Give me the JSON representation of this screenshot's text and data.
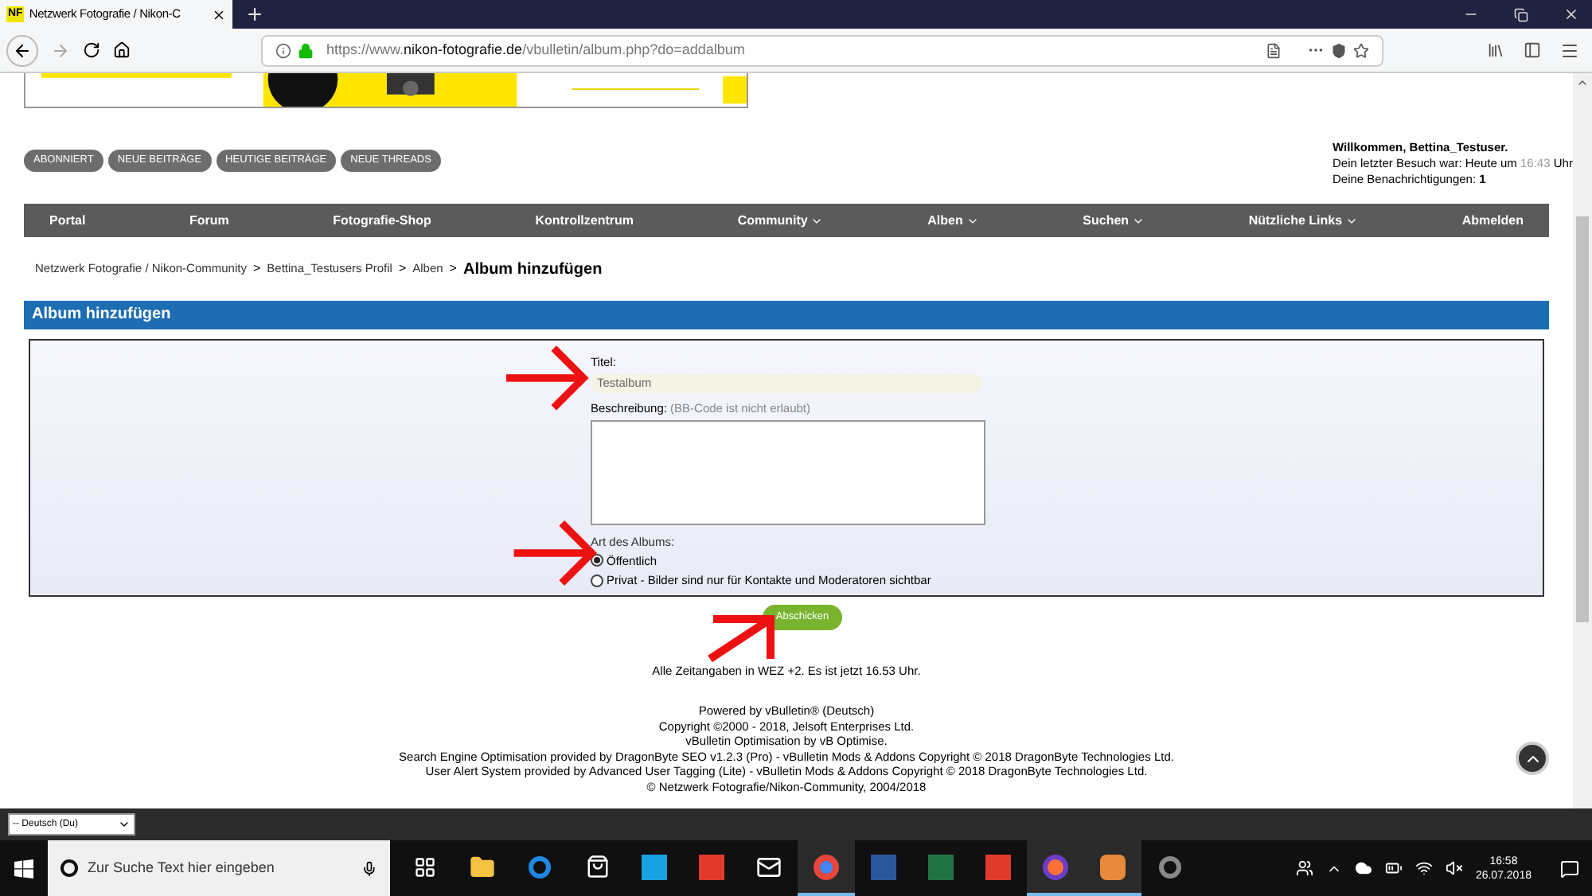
{
  "browser": {
    "tab": {
      "icon_text": "NF",
      "title": "Netzwerk Fotografie / Nikon-C",
      "selected": true
    },
    "url": {
      "prefix": "https://www.",
      "domain": "nikon-fotografie.de",
      "path": "/vbulletin/album.php?do=addalbum"
    }
  },
  "quick_links": [
    "ABONNIERT",
    "NEUE BEITRÄGE",
    "HEUTIGE BEITRÄGE",
    "NEUE THREADS"
  ],
  "welcome": {
    "greeting": "Willkommen, Bettina_Testuser.",
    "last_visit_label": "Dein letzter Besuch war: Heute um",
    "last_visit_time": "16:43",
    "last_visit_suffix": "Uhr",
    "notifications_label": "Deine Benachrichtigungen:",
    "notifications_count": "1"
  },
  "nav": [
    {
      "label": "Portal",
      "dropdown": false
    },
    {
      "label": "Forum",
      "dropdown": false
    },
    {
      "label": "Fotografie-Shop",
      "dropdown": false
    },
    {
      "label": "Kontrollzentrum",
      "dropdown": false
    },
    {
      "label": "Community",
      "dropdown": true
    },
    {
      "label": "Alben",
      "dropdown": true
    },
    {
      "label": "Suchen",
      "dropdown": true
    },
    {
      "label": "Nützliche Links",
      "dropdown": true
    },
    {
      "label": "Abmelden",
      "dropdown": false
    }
  ],
  "breadcrumb": [
    {
      "label": "Netzwerk Fotografie / Nikon-Community",
      "current": false
    },
    {
      "label": "Bettina_Testusers Profil",
      "current": false
    },
    {
      "label": "Alben",
      "current": false
    },
    {
      "label": "Album hinzufügen",
      "current": true
    }
  ],
  "breadcrumb_separator": ">",
  "form": {
    "heading": "Album hinzufügen",
    "title_label": "Titel:",
    "title_value": "Testalbum",
    "description_label": "Beschreibung:",
    "description_hint": "(BB-Code ist nicht erlaubt)",
    "type_label": "Art des Albums:",
    "types": [
      {
        "label": "Öffentlich",
        "selected": true
      },
      {
        "label": "Privat - Bilder sind nur für Kontakte und Moderatoren sichtbar",
        "selected": false
      }
    ],
    "submit": "Abschicken"
  },
  "time_note": "Alle Zeitangaben in WEZ +2. Es ist jetzt 16.53 Uhr.",
  "footer": [
    "Powered by vBulletin® (Deutsch)",
    "Copyright ©2000 - 2018, Jelsoft Enterprises Ltd.",
    "vBulletin Optimisation by vB Optimise.",
    "Search Engine Optimisation provided by DragonByte SEO v1.2.3 (Pro) - vBulletin Mods & Addons Copyright © 2018 DragonByte Technologies Ltd.",
    "User Alert System provided by Advanced User Tagging (Lite) - vBulletin Mods & Addons Copyright © 2018 DragonByte Technologies Ltd.",
    "© Netzwerk Fotografie/Nikon-Community, 2004/2018"
  ],
  "language": "-- Deutsch (Du)",
  "taskbar": {
    "search_placeholder": "Zur Suche Text hier eingeben",
    "time": "16:58",
    "date": "26.07.2018",
    "apps": [
      {
        "kind": "taskview",
        "active": false
      },
      {
        "kind": "folder",
        "active": false
      },
      {
        "kind": "edge",
        "active": false
      },
      {
        "kind": "store",
        "active": false
      },
      {
        "kind": "tile-blue",
        "active": false
      },
      {
        "kind": "tile-red",
        "active": false
      },
      {
        "kind": "mail",
        "active": false
      },
      {
        "kind": "chrome",
        "active": true
      },
      {
        "kind": "word",
        "active": false
      },
      {
        "kind": "excel",
        "active": false
      },
      {
        "kind": "tile-red",
        "active": false
      },
      {
        "kind": "firefox",
        "active": true
      },
      {
        "kind": "tile-orange",
        "active": true
      },
      {
        "kind": "ring",
        "active": false
      }
    ]
  }
}
